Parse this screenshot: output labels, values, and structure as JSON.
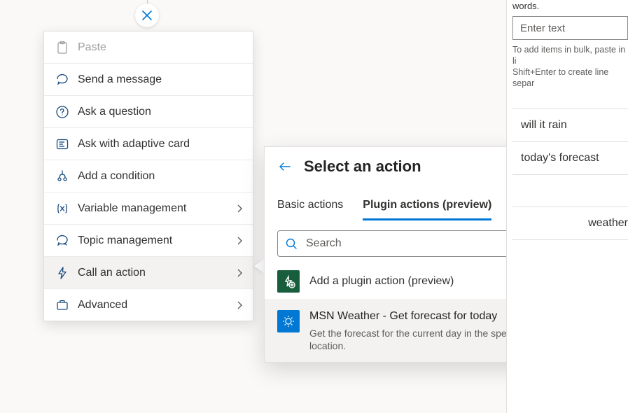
{
  "close_node": {
    "tooltip": "Close"
  },
  "context_menu": {
    "items": [
      {
        "label": "Paste",
        "icon": "paste-icon",
        "disabled": true,
        "has_sub": false
      },
      {
        "label": "Send a message",
        "icon": "message-icon",
        "disabled": false,
        "has_sub": false
      },
      {
        "label": "Ask a question",
        "icon": "question-icon",
        "disabled": false,
        "has_sub": false
      },
      {
        "label": "Ask with adaptive card",
        "icon": "adaptive-card-icon",
        "disabled": false,
        "has_sub": false
      },
      {
        "label": "Add a condition",
        "icon": "condition-icon",
        "disabled": false,
        "has_sub": false
      },
      {
        "label": "Variable management",
        "icon": "variable-icon",
        "disabled": false,
        "has_sub": true
      },
      {
        "label": "Topic management",
        "icon": "topic-icon",
        "disabled": false,
        "has_sub": true
      },
      {
        "label": "Call an action",
        "icon": "action-icon",
        "disabled": false,
        "has_sub": true,
        "selected": true
      },
      {
        "label": "Advanced",
        "icon": "advanced-icon",
        "disabled": false,
        "has_sub": true
      }
    ]
  },
  "action_panel": {
    "title": "Select an action",
    "tabs": {
      "basic": "Basic actions",
      "plugin": "Plugin actions (preview)",
      "active": "plugin"
    },
    "search_placeholder": "Search",
    "add_plugin_label": "Add a plugin action (preview)",
    "plugins": [
      {
        "title": "MSN Weather - Get forecast for today",
        "desc": "Get the forecast for the current day in the specified location."
      }
    ]
  },
  "right_panel": {
    "intro_tail": "words.",
    "input_placeholder": "Enter text",
    "help_text": "To add items in bulk, paste in line-separated phrases. Shift+Enter to create line separators.",
    "entries": [
      "will it rain",
      "today's forecast",
      "weather"
    ]
  }
}
